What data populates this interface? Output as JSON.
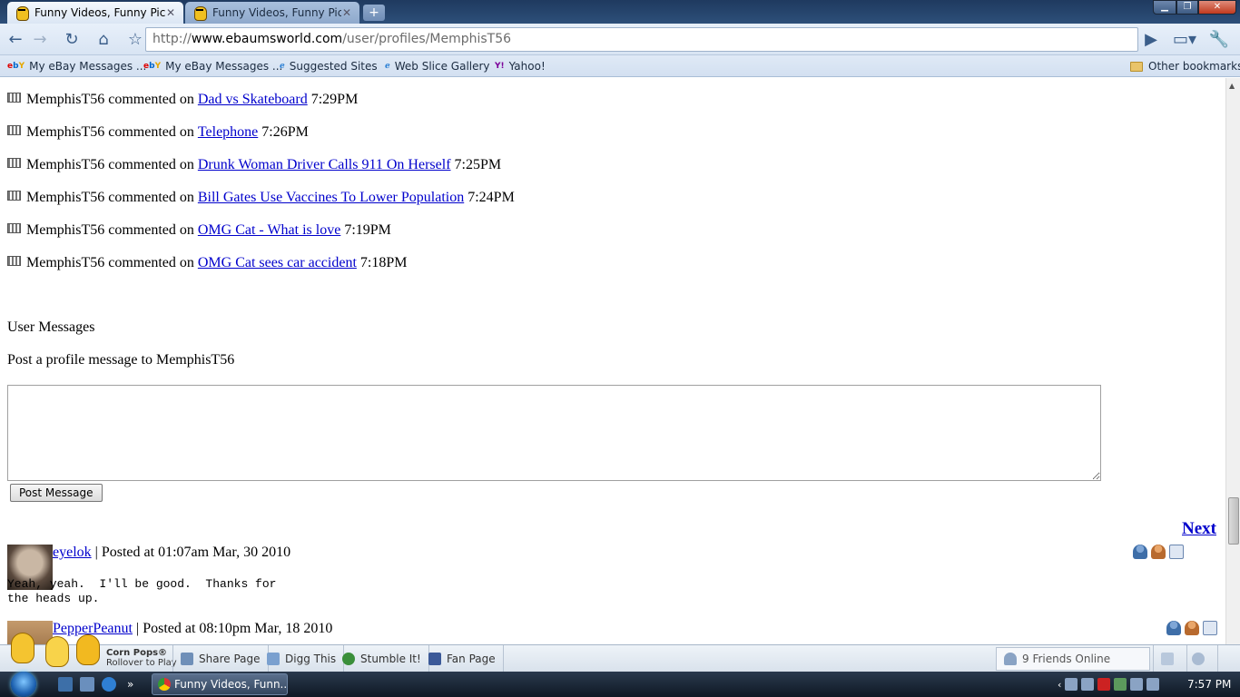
{
  "browser": {
    "tabs": [
      {
        "title": "Funny Videos, Funny Pict...",
        "active": true
      },
      {
        "title": "Funny Videos, Funny Pict...",
        "active": false
      }
    ],
    "url_scheme": "http://",
    "url_host": "www.ebaumsworld.com",
    "url_path": "/user/profiles/MemphisT56",
    "bookmarks": [
      {
        "label": "My eBay Messages ...",
        "icon": "ebay-icon"
      },
      {
        "label": "My eBay Messages ...",
        "icon": "ebay-icon"
      },
      {
        "label": "Suggested Sites",
        "icon": "ie-icon"
      },
      {
        "label": "Web Slice Gallery",
        "icon": "ie-icon"
      },
      {
        "label": "Yahoo!",
        "icon": "yahoo-icon"
      }
    ],
    "other_bookmarks": "Other bookmarks"
  },
  "activity": [
    {
      "user": "MemphisT56",
      "verb": "commented on",
      "link": "Dad vs Skateboard",
      "time": "7:29PM"
    },
    {
      "user": "MemphisT56",
      "verb": "commented on",
      "link": "Telephone",
      "time": "7:26PM"
    },
    {
      "user": "MemphisT56",
      "verb": "commented on",
      "link": "Drunk Woman Driver Calls 911 On Herself",
      "time": "7:25PM"
    },
    {
      "user": "MemphisT56",
      "verb": "commented on",
      "link": "Bill Gates Use Vaccines To Lower Population",
      "time": "7:24PM"
    },
    {
      "user": "MemphisT56",
      "verb": "commented on",
      "link": "OMG Cat - What is love",
      "time": "7:19PM"
    },
    {
      "user": "MemphisT56",
      "verb": "commented on",
      "link": "OMG Cat sees car accident",
      "time": "7:18PM"
    }
  ],
  "messages": {
    "section_title": "User Messages",
    "post_prompt": "Post a profile message to MemphisT56",
    "textarea_value": "",
    "post_button": "Post Message",
    "next_label": "Next",
    "posts": [
      {
        "user": "eyelok",
        "meta": " | Posted at 01:07am Mar, 30 2010",
        "body": "Yeah, yeah.  I'll be good.  Thanks for\nthe heads up."
      },
      {
        "user": "PepperPeanut",
        "meta": " | Posted at 08:10pm Mar, 18 2010",
        "body": ""
      }
    ]
  },
  "ebaums_toolbar": {
    "corn_title": "Corn Pops®",
    "corn_sub": "Rollover to Play",
    "share": "Share Page",
    "digg": "Digg This",
    "stumble": "Stumble It!",
    "fan": "Fan Page",
    "friends": "9 Friends Online"
  },
  "taskbar": {
    "window_title": "Funny Videos, Funn...",
    "clock": "7:57 PM"
  }
}
